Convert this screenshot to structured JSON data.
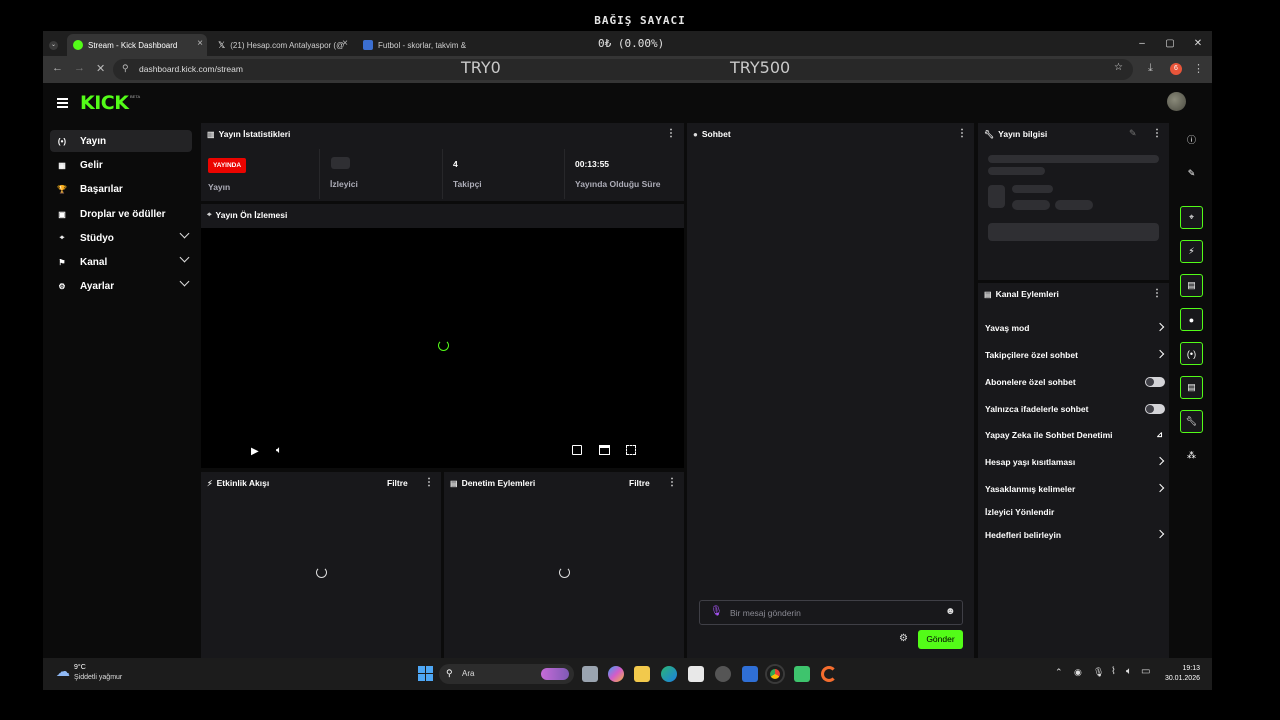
{
  "overlay": {
    "donation_title": "BAĞIŞ SAYACI",
    "donation_percent": "0₺ (0.00%)",
    "goal_start": "TRY0",
    "goal_end": "TRY500"
  },
  "browser": {
    "tabs": [
      {
        "title": "Stream - Kick Dashboard",
        "active": true
      },
      {
        "title": "(21) Hesap.com Antalyaspor (@",
        "active": false
      },
      {
        "title": "Futbol - skorlar, takvim &",
        "active": false
      }
    ],
    "url": "dashboard.kick.com/stream",
    "window_controls": [
      "–",
      "▢",
      "✕"
    ],
    "extension_badge": "6"
  },
  "app": {
    "logo": "KICK",
    "logo_badge": "BETA",
    "sidebar": [
      {
        "label": "Yayın",
        "icon": "broadcast-icon",
        "glyph": "(•)",
        "active": true,
        "expandable": false
      },
      {
        "label": "Gelir",
        "icon": "revenue-icon",
        "glyph": "▦",
        "active": false,
        "expandable": false
      },
      {
        "label": "Başarılar",
        "icon": "trophy-icon",
        "glyph": "🏆",
        "active": false,
        "expandable": false
      },
      {
        "label": "Droplar ve ödüller",
        "icon": "gift-icon",
        "glyph": "▣",
        "active": false,
        "expandable": false
      },
      {
        "label": "Stüdyo",
        "icon": "studio-icon",
        "glyph": "⌖",
        "active": false,
        "expandable": true
      },
      {
        "label": "Kanal",
        "icon": "channel-icon",
        "glyph": "⚑",
        "active": false,
        "expandable": true
      },
      {
        "label": "Ayarlar",
        "icon": "settings-icon",
        "glyph": "⚙",
        "active": false,
        "expandable": true
      }
    ],
    "stats": {
      "title": "Yayın İstatistikleri",
      "live_badge": "YAYINDA",
      "stream_label": "Yayın",
      "viewers_label": "İzleyici",
      "followers_value": "4",
      "followers_label": "Takipçi",
      "uptime_value": "00:13:55",
      "uptime_label": "Yayında Olduğu Süre"
    },
    "preview": {
      "title": "Yayın Ön İzlemesi"
    },
    "activity": {
      "title": "Etkinlik Akışı",
      "filter": "Filtre"
    },
    "moderation": {
      "title": "Denetim Eylemleri",
      "filter": "Filtre"
    },
    "chat": {
      "title": "Sohbet",
      "placeholder": "Bir mesaj gönderin",
      "send": "Gönder"
    },
    "stream_info": {
      "title": "Yayın bilgisi"
    },
    "channel_actions": {
      "title": "Kanal Eylemleri",
      "items": [
        {
          "label": "Yavaş mod",
          "control": "arrow"
        },
        {
          "label": "Takipçilere özel sohbet",
          "control": "arrow"
        },
        {
          "label": "Abonelere özel sohbet",
          "control": "toggle"
        },
        {
          "label": "Yalnızca ifadelerle sohbet",
          "control": "toggle"
        },
        {
          "label": "Yapay Zeka ile Sohbet Denetimi",
          "control": "chart"
        },
        {
          "label": "Hesap yaşı kısıtlaması",
          "control": "arrow"
        },
        {
          "label": "Yasaklanmış kelimeler",
          "control": "arrow"
        },
        {
          "label": "İzleyici Yönlendir",
          "control": "none"
        },
        {
          "label": "Hedefleri belirleyin",
          "control": "arrow"
        }
      ]
    }
  },
  "taskbar": {
    "weather_temp": "9°C",
    "weather_desc": "Şiddetli yağmur",
    "search": "Ara",
    "time": "19:13",
    "date": "30.01.2026"
  },
  "colors": {
    "accent": "#53fc18",
    "live": "#eb0400",
    "panel": "#18181b",
    "background": "#0b0b0b"
  }
}
